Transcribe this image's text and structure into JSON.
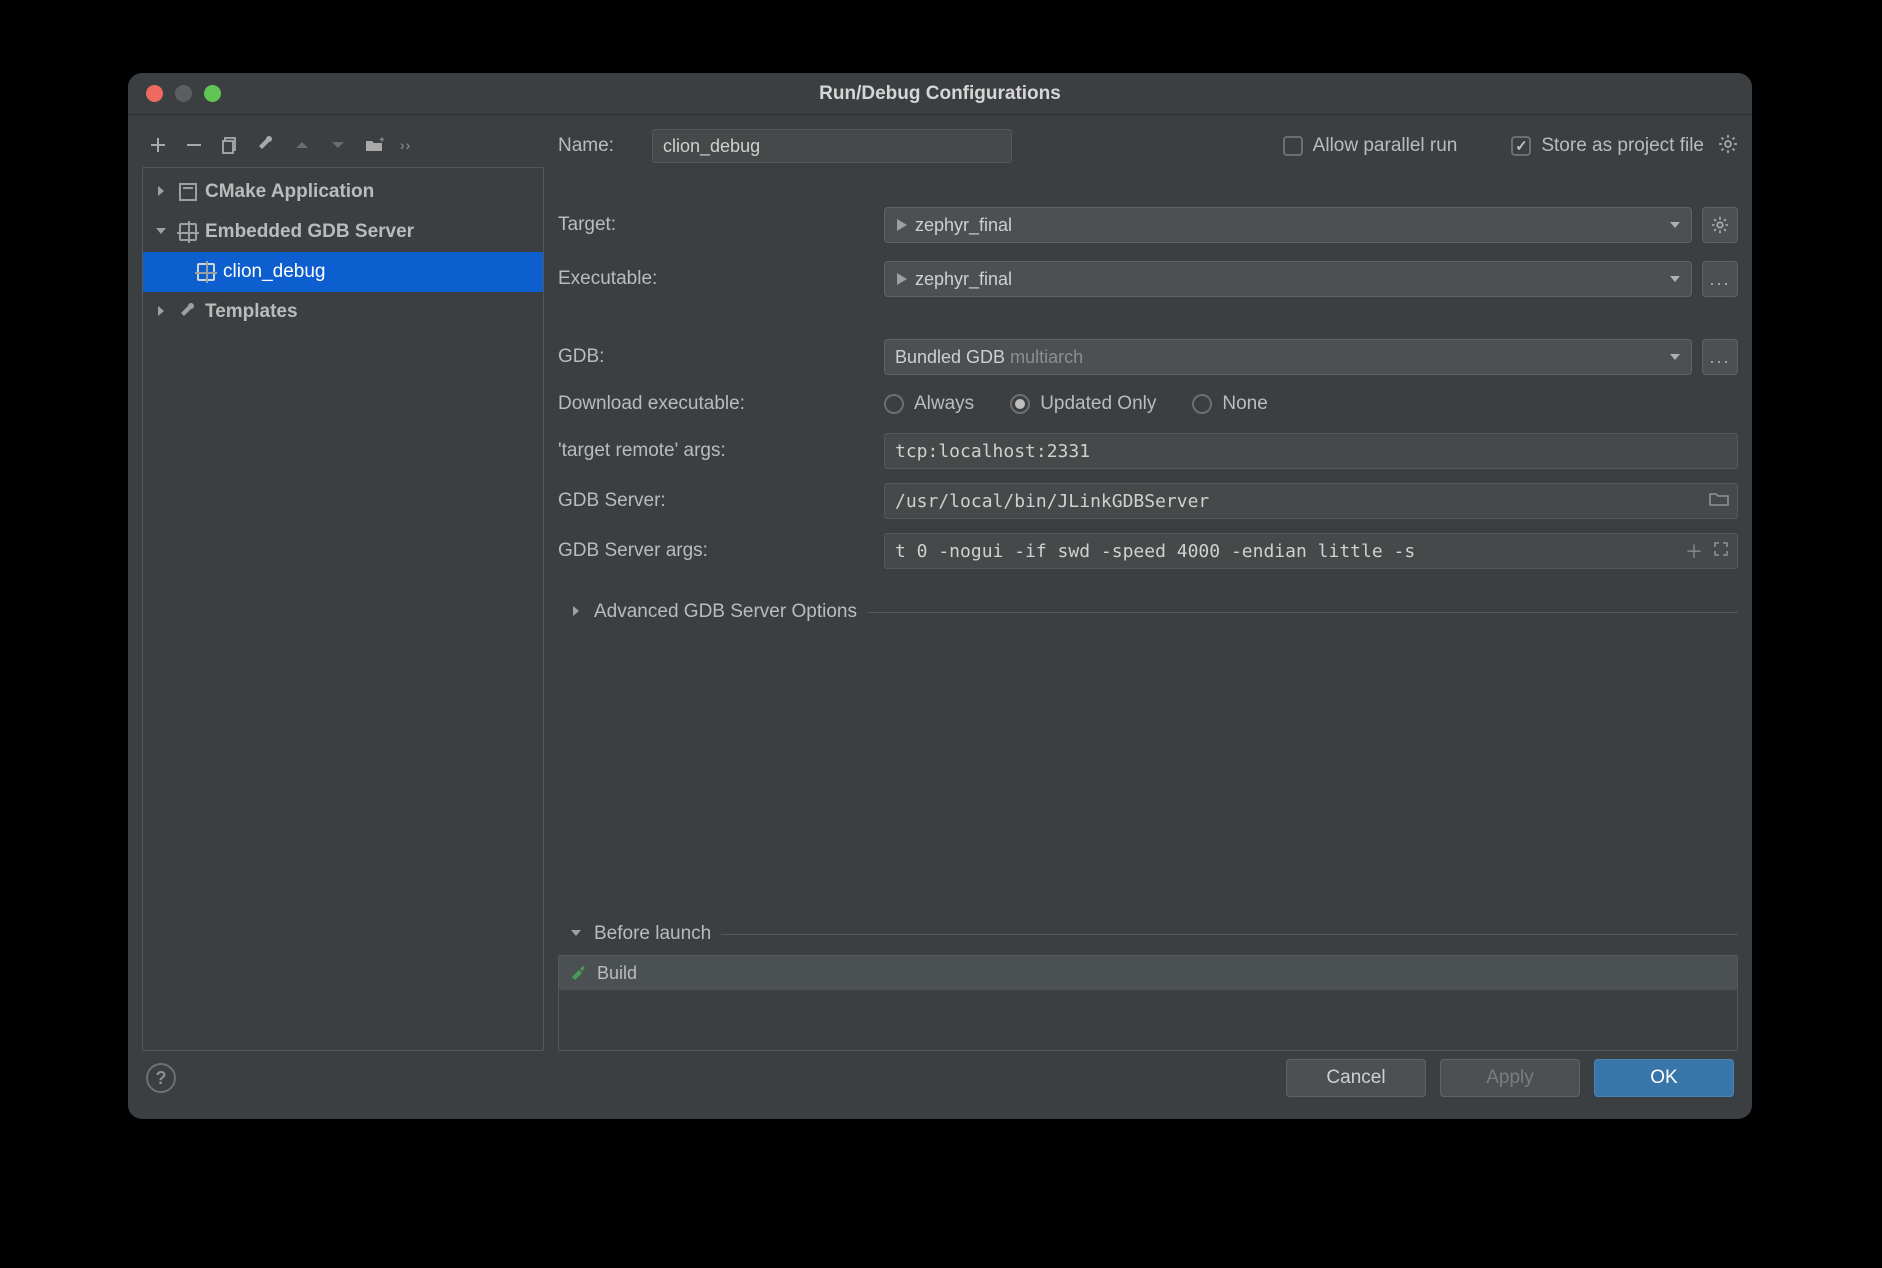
{
  "window": {
    "title": "Run/Debug Configurations"
  },
  "name_row": {
    "label": "Name:",
    "value": "clion_debug",
    "allow_parallel": "Allow parallel run",
    "store_as_project": "Store as project file"
  },
  "sidebar": {
    "items": [
      {
        "label": "CMake Application",
        "expanded": false
      },
      {
        "label": "Embedded GDB Server",
        "expanded": true
      },
      {
        "label": "clion_debug",
        "selected": true
      },
      {
        "label": "Templates",
        "expanded": false
      }
    ]
  },
  "form": {
    "target_label": "Target:",
    "target_value": "zephyr_final",
    "exec_label": "Executable:",
    "exec_value": "zephyr_final",
    "gdb_label": "GDB:",
    "gdb_value": "Bundled GDB ",
    "gdb_value_dim": "multiarch",
    "download_label": "Download executable:",
    "download_options": [
      "Always",
      "Updated Only",
      "None"
    ],
    "download_selected": 1,
    "remote_label": "'target remote' args:",
    "remote_value": "tcp:localhost:2331",
    "server_label": "GDB Server:",
    "server_value": "/usr/local/bin/JLinkGDBServer",
    "server_args_label": "GDB Server args:",
    "server_args_value": "t 0 -nogui -if swd -speed 4000 -endian little -s",
    "advanced_label": "Advanced GDB Server Options",
    "before_launch_label": "Before launch",
    "before_item": "Build"
  },
  "buttons": {
    "cancel": "Cancel",
    "apply": "Apply",
    "ok": "OK"
  }
}
